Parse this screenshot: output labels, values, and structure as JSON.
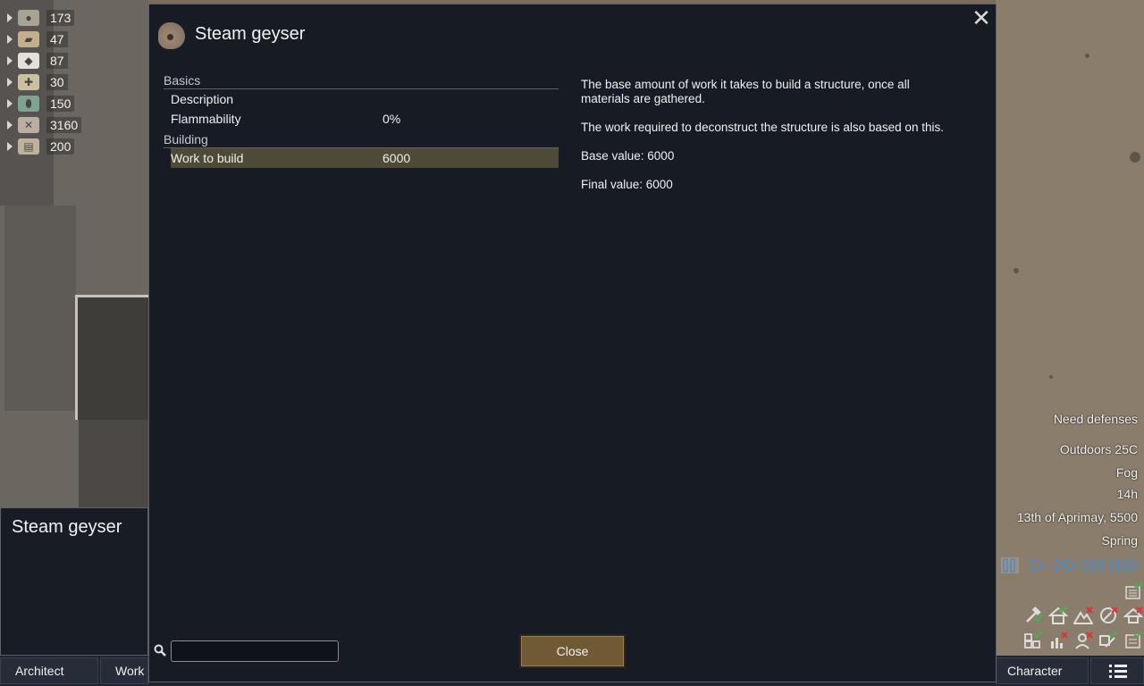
{
  "resources": [
    {
      "icon": "silver-icon",
      "value": "173"
    },
    {
      "icon": "wood-icon",
      "value": "47"
    },
    {
      "icon": "cloth-icon",
      "value": "87"
    },
    {
      "icon": "medicine-icon",
      "value": "30"
    },
    {
      "icon": "component-icon",
      "value": "150"
    },
    {
      "icon": "steel-icon",
      "value": "3160"
    },
    {
      "icon": "stone-icon",
      "value": "200"
    }
  ],
  "dialog": {
    "title": "Steam geyser",
    "categories": {
      "basics": "Basics",
      "building": "Building"
    },
    "stats": {
      "description": {
        "label": "Description",
        "value": ""
      },
      "flammability": {
        "label": "Flammability",
        "value": "0%"
      },
      "work_to_build": {
        "label": "Work to build",
        "value": "6000"
      }
    },
    "detail": {
      "p1": "The base amount of work it takes to build a structure, once all materials are gathered.",
      "p2": "The work required to deconstruct the structure is also based on this.",
      "p3": "Base value: 6000",
      "p4": "Final value: 6000"
    },
    "search": {
      "value": "",
      "placeholder": ""
    },
    "close_label": "Close"
  },
  "inspect": {
    "title": "Steam geyser"
  },
  "tabs": {
    "architect": "Architect",
    "work": "Work",
    "character": "Character"
  },
  "info": {
    "alert": "Need defenses",
    "temperature": "Outdoors 25C",
    "weather": "Fog",
    "hour": "14h",
    "date": "13th of Aprimay, 5500",
    "season": "Spring"
  },
  "colors": {
    "dialog_bg": "#161b24",
    "selected_row": "#4d4a37",
    "close_button": "#6f5a34",
    "speed_icon": "#4e89c8"
  }
}
